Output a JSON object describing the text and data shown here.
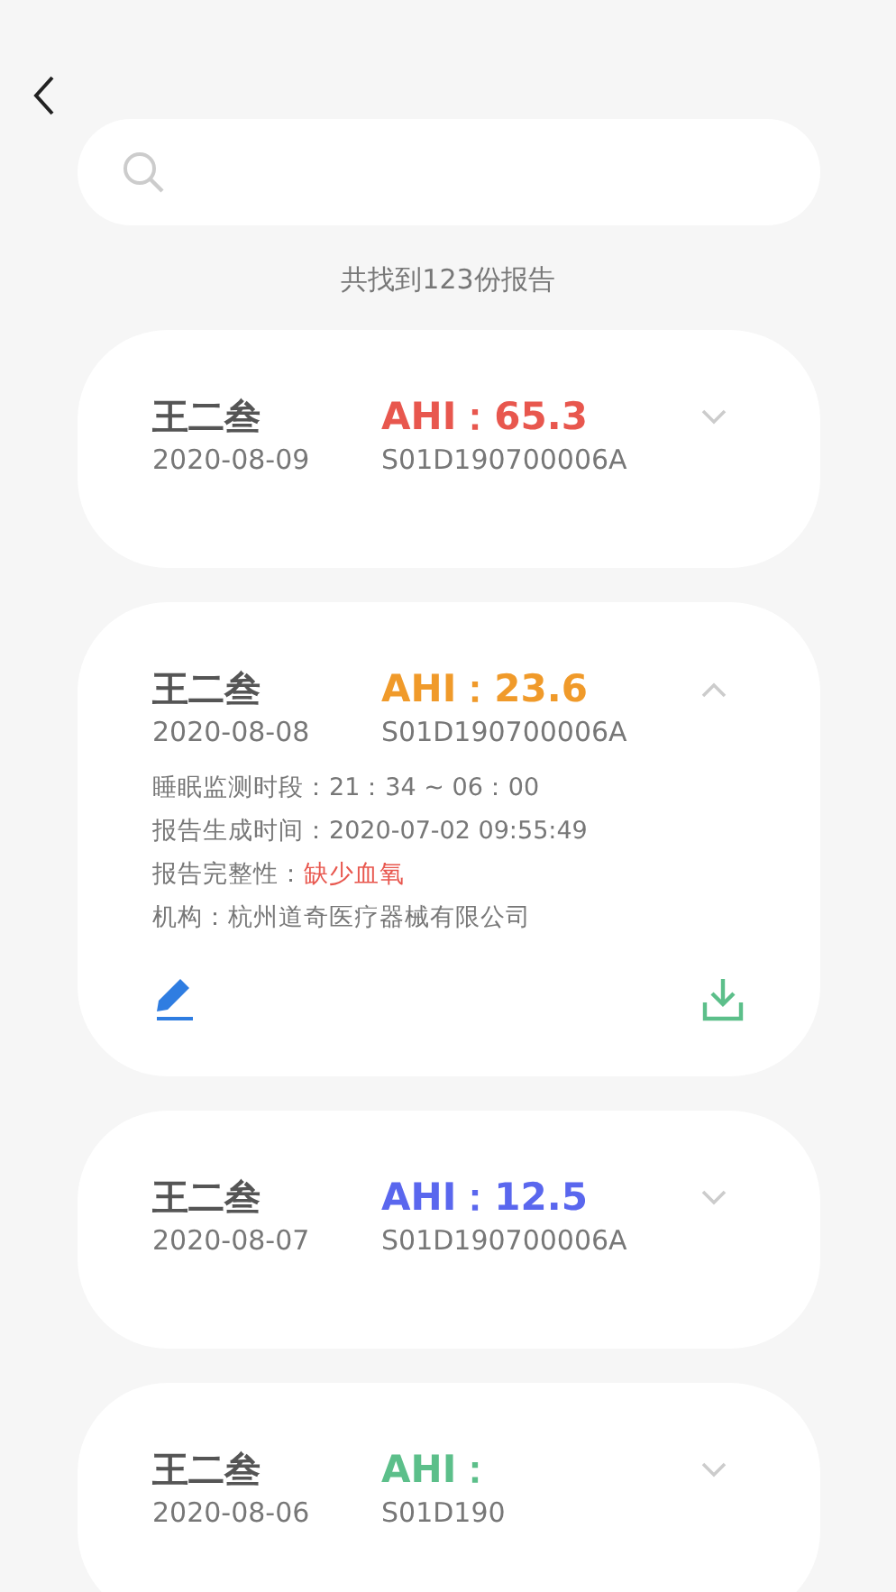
{
  "result_count": "共找到123份报告",
  "reports": [
    {
      "name": "王二叁",
      "date": "2020-08-09",
      "ahi": "AHI：65.3",
      "color": "#e8574e",
      "serial": "S01D190700006A",
      "expanded": false
    },
    {
      "name": "王二叁",
      "date": "2020-08-08",
      "ahi": "AHI：23.6",
      "color": "#f09a2a",
      "serial": "S01D190700006A",
      "expanded": true,
      "details": [
        {
          "label": "睡眠监测时段：",
          "value": "21：34 ~ 06：00",
          "warning": false
        },
        {
          "label": "报告生成时间：",
          "value": "2020-07-02 09:55:49",
          "warning": false
        },
        {
          "label": "报告完整性：",
          "value": "缺少血氧",
          "warning": true
        },
        {
          "label": "机构：",
          "value": "杭州道奇医疗器械有限公司",
          "warning": false
        }
      ]
    },
    {
      "name": "王二叁",
      "date": "2020-08-07",
      "ahi": "AHI：12.5",
      "color": "#5a67ee",
      "serial": "S01D190700006A",
      "expanded": false
    },
    {
      "name": "王二叁",
      "date": "2020-08-06",
      "ahi": "AHI：",
      "color": "#5cbf8a",
      "serial": "S01D190",
      "expanded": false
    }
  ]
}
